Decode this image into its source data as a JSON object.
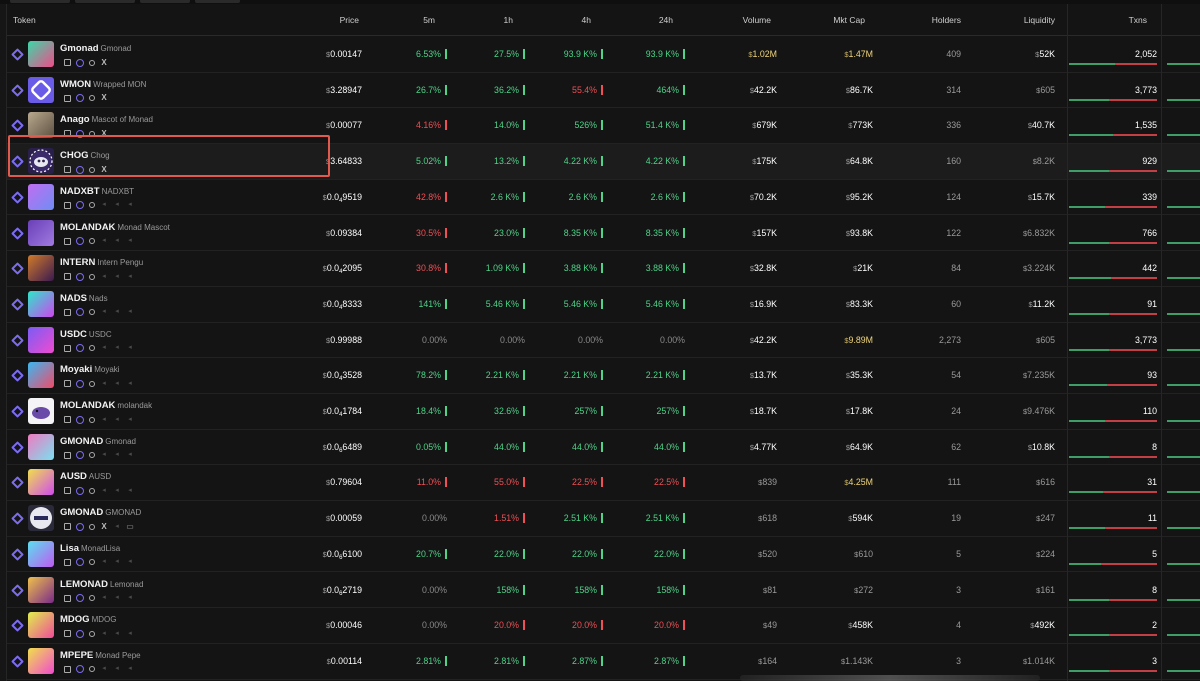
{
  "header": {
    "token": "Token",
    "price": "Price",
    "m5": "5m",
    "h1": "1h",
    "h4": "4h",
    "h24": "24h",
    "volume": "Volume",
    "mktcap": "Mkt Cap",
    "holders": "Holders",
    "liquidity": "Liquidity",
    "txns": "Txns"
  },
  "colors": {
    "positive": "#4fd38a",
    "negative": "#ef4f55",
    "neutral": "#8a8a8a",
    "accent": "#7b6cf0",
    "highlight_border": "#e05a4e",
    "gold": "#f0d47a"
  },
  "highlighted_row_index": 3,
  "rows": [
    {
      "sym": "Gmonad",
      "full": "Gmonad",
      "icons": [
        "copy-icon",
        "ring-icon",
        "search-icon",
        "x-icon"
      ],
      "avatar": "linear-gradient(135deg,#3ad8a8,#f04b8a)",
      "price": "0.00147",
      "m5": "6.53%",
      "h1": "27.5%",
      "h4": "93.9 K%",
      "h24": "93.9 K%",
      "c5": "pos",
      "c1": "pos",
      "c4": "pos",
      "c24": "pos",
      "vol": "1.02M",
      "volc": "gold",
      "mc": "1.47M",
      "mcc": "gold",
      "holders": "409",
      "liq": "52K",
      "liqc": "",
      "tx": "2,052",
      "txg": 58,
      "txr": 42
    },
    {
      "sym": "WMON",
      "full": "Wrapped MON",
      "icons": [
        "copy-icon",
        "ring-icon",
        "search-icon",
        "x-icon"
      ],
      "avatar": "wmon",
      "price": "3.28947",
      "m5": "26.7%",
      "h1": "36.2%",
      "h4": "55.4%",
      "h24": "464%",
      "c5": "pos",
      "c1": "pos",
      "c4": "neg",
      "c24": "pos",
      "vol": "42.2K",
      "volc": "",
      "mc": "86.7K",
      "mcc": "",
      "holders": "314",
      "liq": "605",
      "liqc": "dim",
      "tx": "3,773",
      "txg": 50,
      "txr": 50
    },
    {
      "sym": "Anago",
      "full": "Mascot of Monad",
      "icons": [
        "copy-icon",
        "ring-icon",
        "search-icon",
        "x-icon"
      ],
      "avatar": "linear-gradient(135deg,#b9a98e,#5c5040)",
      "price": "0.00077",
      "m5": "4.16%",
      "h1": "14.0%",
      "h4": "526%",
      "h24": "51.4 K%",
      "c5": "neg",
      "c1": "pos",
      "c4": "pos",
      "c24": "pos",
      "vol": "679K",
      "volc": "",
      "mc": "773K",
      "mcc": "",
      "holders": "336",
      "liq": "40.7K",
      "liqc": "",
      "tx": "1,535",
      "txg": 55,
      "txr": 45
    },
    {
      "sym": "CHOG",
      "full": "Chog",
      "icons": [
        "copy-icon",
        "ring-icon",
        "search-icon",
        "x-icon"
      ],
      "avatar": "chog",
      "price": "3.64833",
      "m5": "5.02%",
      "h1": "13.2%",
      "h4": "4.22 K%",
      "h24": "4.22 K%",
      "c5": "pos",
      "c1": "pos",
      "c4": "pos",
      "c24": "pos",
      "vol": "175K",
      "volc": "",
      "mc": "64.8K",
      "mcc": "",
      "holders": "160",
      "liq": "8.2K",
      "liqc": "dim",
      "tx": "929",
      "txg": 50,
      "txr": 50
    },
    {
      "sym": "NADXBT",
      "full": "NADXBT",
      "icons": [
        "copy-icon",
        "ring-icon",
        "search-icon",
        "dim",
        "dim",
        "dim"
      ],
      "avatar": "linear-gradient(135deg,#c06ef0,#6f8df5)",
      "price": "0.0",
      "psub": "4",
      "ptail": "9519",
      "m5": "42.8%",
      "h1": "2.6 K%",
      "h4": "2.6 K%",
      "h24": "2.6 K%",
      "c5": "neg",
      "c1": "pos",
      "c4": "pos",
      "c24": "pos",
      "vol": "70.2K",
      "volc": "",
      "mc": "95.2K",
      "mcc": "",
      "holders": "124",
      "liq": "15.7K",
      "liqc": "",
      "tx": "339",
      "txg": 45,
      "txr": 55
    },
    {
      "sym": "MOLANDAK",
      "full": "Monad Mascot",
      "icons": [
        "copy-icon",
        "ring-icon",
        "search-icon",
        "dim",
        "dim",
        "dim"
      ],
      "avatar": "linear-gradient(135deg,#6a3fb8,#a07be0)",
      "price": "0.09384",
      "m5": "30.5%",
      "h1": "23.0%",
      "h4": "8.35 K%",
      "h24": "8.35 K%",
      "c5": "neg",
      "c1": "pos",
      "c4": "pos",
      "c24": "pos",
      "vol": "157K",
      "volc": "",
      "mc": "93.8K",
      "mcc": "",
      "holders": "122",
      "liq": "6.832K",
      "liqc": "dim",
      "tx": "766",
      "txg": 50,
      "txr": 50
    },
    {
      "sym": "INTERN",
      "full": "Intern Pengu",
      "icons": [
        "copy-icon",
        "ring-icon",
        "search-icon",
        "dim",
        "dim",
        "dim"
      ],
      "avatar": "linear-gradient(135deg,#d07a2a,#3a1a50)",
      "price": "0.0",
      "psub": "4",
      "ptail": "2095",
      "m5": "30.8%",
      "h1": "1.09 K%",
      "h4": "3.88 K%",
      "h24": "3.88 K%",
      "c5": "neg",
      "c1": "pos",
      "c4": "pos",
      "c24": "pos",
      "vol": "32.8K",
      "volc": "",
      "mc": "21K",
      "mcc": "",
      "holders": "84",
      "liq": "3.224K",
      "liqc": "dim",
      "tx": "442",
      "txg": 52,
      "txr": 48
    },
    {
      "sym": "NADS",
      "full": "Nads",
      "icons": [
        "copy-icon",
        "ring-icon",
        "search-icon",
        "dim",
        "dim",
        "dim"
      ],
      "avatar": "linear-gradient(135deg,#2ae8c8,#d045f0)",
      "price": "0.0",
      "psub": "4",
      "ptail": "8333",
      "m5": "141%",
      "h1": "5.46 K%",
      "h4": "5.46 K%",
      "h24": "5.46 K%",
      "c5": "pos",
      "c1": "pos",
      "c4": "pos",
      "c24": "pos",
      "vol": "16.9K",
      "volc": "",
      "mc": "83.3K",
      "mcc": "",
      "holders": "60",
      "liq": "11.2K",
      "liqc": "",
      "tx": "91",
      "txg": 50,
      "txr": 50
    },
    {
      "sym": "USDC",
      "full": "USDC",
      "icons": [
        "copy-icon",
        "ring-icon",
        "search-icon",
        "dim",
        "dim",
        "dim"
      ],
      "avatar": "linear-gradient(135deg,#7a5cf5,#f04bd0)",
      "price": "0.99988",
      "m5": "0.00%",
      "h1": "0.00%",
      "h4": "0.00%",
      "h24": "0.00%",
      "c5": "zero",
      "c1": "zero",
      "c4": "zero",
      "c24": "zero",
      "vol": "42.2K",
      "volc": "",
      "mc": "9.89M",
      "mcc": "gold",
      "holders": "2,273",
      "liq": "605",
      "liqc": "dim",
      "tx": "3,773",
      "txg": 50,
      "txr": 50
    },
    {
      "sym": "Moyaki",
      "full": "Moyaki",
      "icons": [
        "copy-icon",
        "ring-icon",
        "search-icon",
        "dim",
        "dim",
        "dim"
      ],
      "avatar": "linear-gradient(135deg,#3ab8f0,#f04b6a)",
      "price": "0.0",
      "psub": "4",
      "ptail": "3528",
      "m5": "78.2%",
      "h1": "2.21 K%",
      "h4": "2.21 K%",
      "h24": "2.21 K%",
      "c5": "pos",
      "c1": "pos",
      "c4": "pos",
      "c24": "pos",
      "vol": "13.7K",
      "volc": "",
      "mc": "35.3K",
      "mcc": "",
      "holders": "54",
      "liq": "7.235K",
      "liqc": "dim",
      "tx": "93",
      "txg": 48,
      "txr": 52
    },
    {
      "sym": "MOLANDAK",
      "full": "molandak",
      "icons": [
        "copy-icon",
        "ring-icon",
        "search-icon",
        "dim",
        "dim",
        "dim"
      ],
      "avatar": "molandak",
      "price": "0.0",
      "psub": "4",
      "ptail": "1784",
      "m5": "18.4%",
      "h1": "32.6%",
      "h4": "257%",
      "h24": "257%",
      "c5": "pos",
      "c1": "pos",
      "c4": "pos",
      "c24": "pos",
      "vol": "18.7K",
      "volc": "",
      "mc": "17.8K",
      "mcc": "",
      "holders": "24",
      "liq": "9.476K",
      "liqc": "dim",
      "tx": "110",
      "txg": 45,
      "txr": 55
    },
    {
      "sym": "GMONAD",
      "full": "Gmonad",
      "icons": [
        "copy-icon",
        "ring-icon",
        "search-icon",
        "dim",
        "dim",
        "dim"
      ],
      "avatar": "linear-gradient(135deg,#f07ac0,#7ae0f0)",
      "price": "0.0",
      "psub": "6",
      "ptail": "6489",
      "m5": "0.05%",
      "h1": "44.0%",
      "h4": "44.0%",
      "h24": "44.0%",
      "c5": "pos",
      "c1": "pos",
      "c4": "pos",
      "c24": "pos",
      "vol": "4.77K",
      "volc": "",
      "mc": "64.9K",
      "mcc": "",
      "holders": "62",
      "liq": "10.8K",
      "liqc": "",
      "tx": "8",
      "txg": 50,
      "txr": 50
    },
    {
      "sym": "AUSD",
      "full": "AUSD",
      "icons": [
        "copy-icon",
        "ring-icon",
        "search-icon",
        "dim",
        "dim",
        "dim"
      ],
      "avatar": "linear-gradient(135deg,#f0e04b,#d04bf0)",
      "price": "0.79604",
      "m5": "11.0%",
      "h1": "55.0%",
      "h4": "22.5%",
      "h24": "22.5%",
      "c5": "neg",
      "c1": "neg",
      "c4": "neg",
      "c24": "neg",
      "vol": "839",
      "volc": "dim",
      "mc": "4.25M",
      "mcc": "gold",
      "holders": "111",
      "liq": "616",
      "liqc": "dim",
      "tx": "31",
      "txg": 42,
      "txr": 58
    },
    {
      "sym": "GMONAD",
      "full": "GMONAD",
      "icons": [
        "copy-icon",
        "ring-icon",
        "search-icon",
        "x-icon",
        "dim",
        "monitor-icon"
      ],
      "avatar": "gmonad",
      "price": "0.00059",
      "m5": "0.00%",
      "h1": "1.51%",
      "h4": "2.51 K%",
      "h24": "2.51 K%",
      "c5": "zero",
      "c1": "neg",
      "c4": "pos",
      "c24": "pos",
      "vol": "618",
      "volc": "dim",
      "mc": "594K",
      "mcc": "",
      "holders": "19",
      "liq": "247",
      "liqc": "dim",
      "tx": "11",
      "txg": 45,
      "txr": 55
    },
    {
      "sym": "Lisa",
      "full": "MonadLisa",
      "icons": [
        "copy-icon",
        "ring-icon",
        "search-icon",
        "dim",
        "dim",
        "dim"
      ],
      "avatar": "linear-gradient(135deg,#5ae0f0,#c05af0)",
      "price": "0.0",
      "psub": "6",
      "ptail": "6100",
      "m5": "20.7%",
      "h1": "22.0%",
      "h4": "22.0%",
      "h24": "22.0%",
      "c5": "pos",
      "c1": "pos",
      "c4": "pos",
      "c24": "pos",
      "vol": "520",
      "volc": "dim",
      "mc": "610",
      "mcc": "dim",
      "holders": "5",
      "liq": "224",
      "liqc": "dim",
      "tx": "5",
      "txg": 40,
      "txr": 60
    },
    {
      "sym": "LEMONAD",
      "full": "Lemonad",
      "icons": [
        "copy-icon",
        "ring-icon",
        "search-icon",
        "dim",
        "dim",
        "dim"
      ],
      "avatar": "linear-gradient(135deg,#f0c04b,#7a2a8a)",
      "price": "0.0",
      "psub": "6",
      "ptail": "2719",
      "m5": "0.00%",
      "h1": "158%",
      "h4": "158%",
      "h24": "158%",
      "c5": "zero",
      "c1": "pos",
      "c4": "pos",
      "c24": "pos",
      "vol": "81",
      "volc": "dim",
      "mc": "272",
      "mcc": "dim",
      "holders": "3",
      "liq": "161",
      "liqc": "dim",
      "tx": "8",
      "txg": 50,
      "txr": 50
    },
    {
      "sym": "MDOG",
      "full": "MDOG",
      "icons": [
        "copy-icon",
        "ring-icon",
        "search-icon",
        "dim",
        "dim",
        "dim"
      ],
      "avatar": "linear-gradient(135deg,#e0f04b,#f04b9a)",
      "price": "0.00046",
      "m5": "0.00%",
      "h1": "20.0%",
      "h4": "20.0%",
      "h24": "20.0%",
      "c5": "zero",
      "c1": "neg",
      "c4": "neg",
      "c24": "neg",
      "vol": "49",
      "volc": "dim",
      "mc": "458K",
      "mcc": "",
      "holders": "4",
      "liq": "492K",
      "liqc": "",
      "tx": "2",
      "txg": 50,
      "txr": 50
    },
    {
      "sym": "MPEPE",
      "full": "Monad Pepe",
      "icons": [
        "copy-icon",
        "ring-icon",
        "search-icon",
        "dim",
        "dim",
        "dim"
      ],
      "avatar": "linear-gradient(135deg,#f0e04b,#f04bd0)",
      "price": "0.00114",
      "m5": "2.81%",
      "h1": "2.81%",
      "h4": "2.87%",
      "h24": "2.87%",
      "c5": "pos",
      "c1": "pos",
      "c4": "pos",
      "c24": "pos",
      "vol": "164",
      "volc": "dim",
      "mc": "1.143K",
      "mcc": "dim",
      "holders": "3",
      "liq": "1.014K",
      "liqc": "dim",
      "tx": "3",
      "txg": 50,
      "txr": 50
    }
  ]
}
